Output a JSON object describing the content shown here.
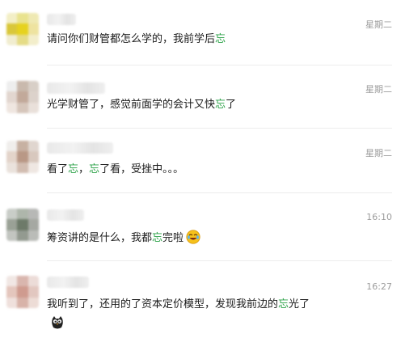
{
  "comments": [
    {
      "time": "星期二",
      "text": [
        {
          "t": "请问你们财管都怎么学的，我前学后",
          "hl": false
        },
        {
          "t": "忘",
          "hl": true
        }
      ],
      "emoji": null
    },
    {
      "time": "星期二",
      "text": [
        {
          "t": "光学财管了，感觉前面学的会计又快",
          "hl": false
        },
        {
          "t": "忘",
          "hl": true
        },
        {
          "t": "了",
          "hl": false
        }
      ],
      "emoji": null
    },
    {
      "time": "星期二",
      "text": [
        {
          "t": "看了",
          "hl": false
        },
        {
          "t": "忘",
          "hl": true
        },
        {
          "t": "，",
          "hl": false
        },
        {
          "t": "忘",
          "hl": true
        },
        {
          "t": "了看，受挫中。。。",
          "hl": false
        }
      ],
      "emoji": null
    },
    {
      "time": "16:10",
      "text": [
        {
          "t": "筹资讲的是什么，我都",
          "hl": false
        },
        {
          "t": "忘",
          "hl": true
        },
        {
          "t": "完啦",
          "hl": false
        }
      ],
      "emoji": "laughing-crying-emoji"
    },
    {
      "time": "16:27",
      "text": [
        {
          "t": "我听到了，还用的了资本定价模型，发现我前边的",
          "hl": false
        },
        {
          "t": "忘",
          "hl": true
        },
        {
          "t": "光了",
          "hl": false
        }
      ],
      "emoji": "owl-emoji"
    }
  ],
  "colors": {
    "highlight": "#2aa146",
    "text": "#1a1a1a",
    "time": "#9c9c9c",
    "divider": "#ececec"
  },
  "avatars": [
    [
      "#f3efc6",
      "#e9e38e",
      "#efe9b3",
      "#d9c73a",
      "#e6d21f",
      "#eee3a0",
      "#f1edd0",
      "#e5dc86",
      "#f3eecb"
    ],
    [
      "#eeeeee",
      "#c9b9ad",
      "#d8cfc7",
      "#e2d6cf",
      "#c2a99a",
      "#dcd2cb",
      "#efe6e0",
      "#d6c6bb",
      "#e9e0da"
    ],
    [
      "#f0eeec",
      "#c7b1a2",
      "#e0d6cf",
      "#e3d4ca",
      "#b99886",
      "#d8c8be",
      "#eae2dc",
      "#d2bdb1",
      "#efe7e2"
    ],
    [
      "#c9cdc8",
      "#aeb6ab",
      "#b7b8b6",
      "#9aa196",
      "#6d7a69",
      "#a5a8a2",
      "#c2c5c0",
      "#939a90",
      "#babcb8"
    ],
    [
      "#f1e7e4",
      "#d9b6ae",
      "#ecdcd8",
      "#e4c6bd",
      "#cf9b8f",
      "#e2c7c0",
      "#efe0dc",
      "#d8b3a9",
      "#eddcd6"
    ]
  ]
}
